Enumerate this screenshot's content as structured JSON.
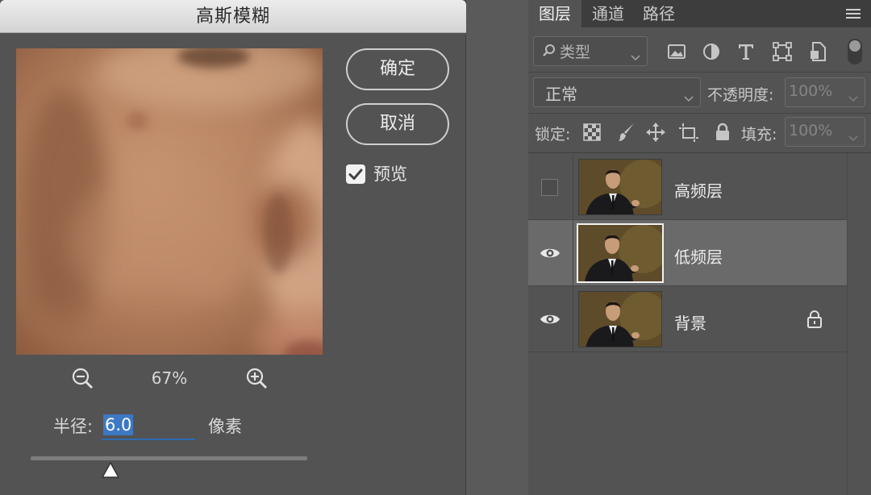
{
  "dialog": {
    "title": "高斯模糊",
    "ok_label": "确定",
    "cancel_label": "取消",
    "preview_label": "预览",
    "preview_checked": true,
    "zoom_level": "67%",
    "radius_label": "半径:",
    "radius_value": "6.0",
    "radius_unit": "像素",
    "slider_position": 0.29
  },
  "layers_panel": {
    "tabs": [
      {
        "label": "图层",
        "active": true
      },
      {
        "label": "通道",
        "active": false
      },
      {
        "label": "路径",
        "active": false
      }
    ],
    "filter": {
      "label": "类型"
    },
    "filter_tools": [
      "image-icon",
      "adjustment-icon",
      "type-icon",
      "shape-icon",
      "smart-object-icon"
    ],
    "blend_mode": "正常",
    "opacity_label": "不透明度:",
    "opacity_value": "100%",
    "lock_label": "锁定:",
    "lock_tools": [
      "transparent-pixels-icon",
      "brush-icon",
      "move-icon",
      "artboard-icon",
      "lock-icon"
    ],
    "fill_label": "填充:",
    "fill_value": "100%",
    "layers": [
      {
        "name": "高频层",
        "visible": false,
        "selected": false,
        "locked": false
      },
      {
        "name": "低频层",
        "visible": true,
        "selected": true,
        "locked": false
      },
      {
        "name": "背景",
        "visible": true,
        "selected": false,
        "locked": true
      }
    ]
  },
  "colors": {
    "panel": "#535353",
    "selection": "#6a6a6a",
    "accent": "#3d78c4"
  }
}
